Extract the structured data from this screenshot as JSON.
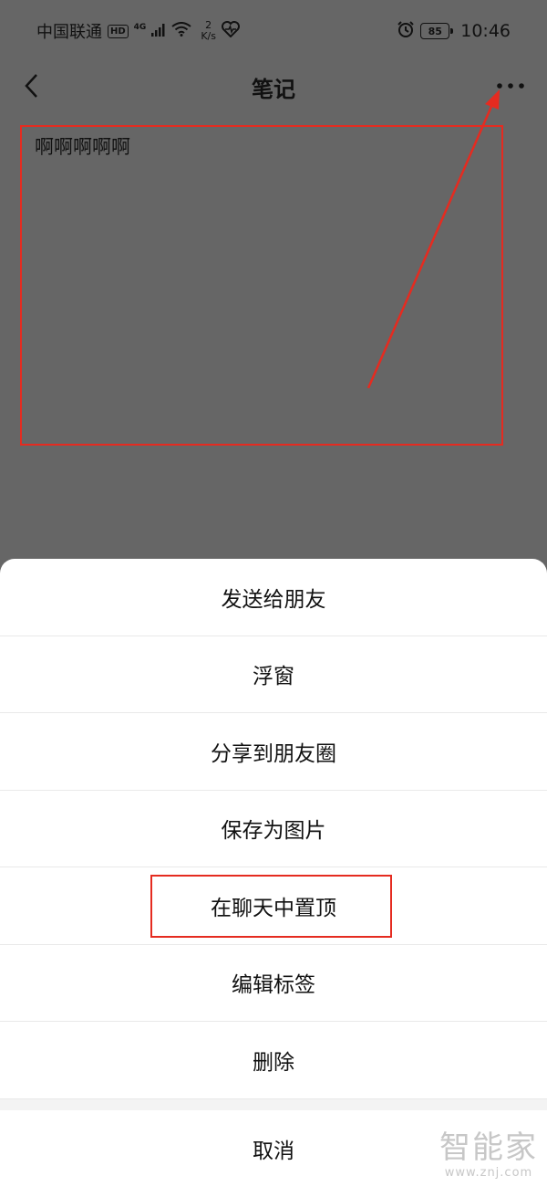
{
  "status_bar": {
    "carrier": "中国联通",
    "hd": "HD",
    "network": "4G",
    "speed_value": "2",
    "speed_unit": "K/s",
    "battery": "85",
    "time": "10:46"
  },
  "header": {
    "title": "笔记"
  },
  "note": {
    "content": "啊啊啊啊啊"
  },
  "action_sheet": {
    "items": [
      {
        "label": "发送给朋友"
      },
      {
        "label": "浮窗"
      },
      {
        "label": "分享到朋友圈"
      },
      {
        "label": "保存为图片"
      },
      {
        "label": "在聊天中置顶"
      },
      {
        "label": "编辑标签"
      },
      {
        "label": "删除"
      }
    ],
    "cancel": "取消"
  },
  "watermark": {
    "brand": "智能家",
    "url": "www.znj.com"
  },
  "colors": {
    "overlay": "#666666",
    "annotation_red": "#e52b20",
    "sheet_bg": "#ffffff"
  }
}
